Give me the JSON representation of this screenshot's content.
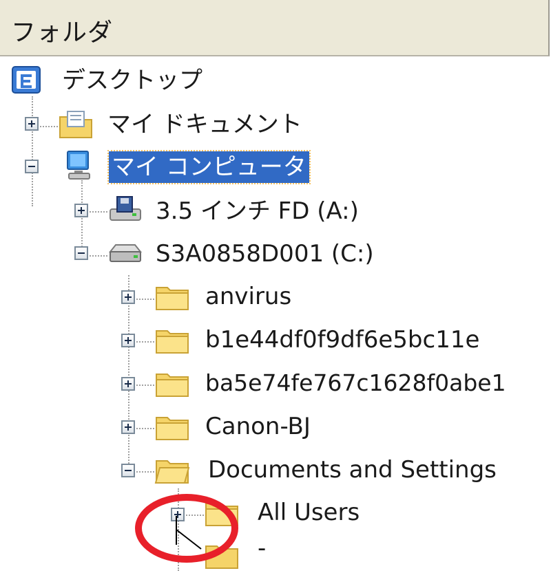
{
  "panel": {
    "title": "フォルダ"
  },
  "tree": [
    {
      "id": "desktop",
      "label": "デスクトップ",
      "icon": "desktop-icon",
      "expander": "none"
    },
    {
      "id": "my-documents",
      "label": "マイ ドキュメント",
      "icon": "documents-folder-icon",
      "expander": "plus"
    },
    {
      "id": "my-computer",
      "label": "マイ コンピュータ",
      "icon": "computer-icon",
      "expander": "minus",
      "selected": true
    },
    {
      "id": "floppy",
      "label": "3.5 インチ FD (A:)",
      "icon": "floppy-drive-icon",
      "expander": "plus"
    },
    {
      "id": "drive-c",
      "label": "S3A0858D001 (C:)",
      "icon": "hard-drive-icon",
      "expander": "minus"
    },
    {
      "id": "anvirus",
      "label": "anvirus",
      "icon": "folder-icon",
      "expander": "plus"
    },
    {
      "id": "b1e44",
      "label": "b1e44df0f9df6e5bc11e",
      "icon": "folder-icon",
      "expander": "plus"
    },
    {
      "id": "ba5e7",
      "label": "ba5e74fe767c1628f0abe1",
      "icon": "folder-icon",
      "expander": "plus"
    },
    {
      "id": "canon",
      "label": "Canon-BJ",
      "icon": "folder-icon",
      "expander": "plus"
    },
    {
      "id": "docs-settings",
      "label": "Documents and Settings",
      "icon": "open-folder-icon",
      "expander": "minus"
    },
    {
      "id": "all-users",
      "label": "All Users",
      "icon": "folder-icon",
      "expander": "plus"
    },
    {
      "id": "partial",
      "label": "-",
      "icon": "folder-icon",
      "expander": "none"
    }
  ],
  "colors": {
    "selection": "#316ac5",
    "annotation_circle": "#e8202a",
    "folder_yellow": "#f5d469"
  }
}
